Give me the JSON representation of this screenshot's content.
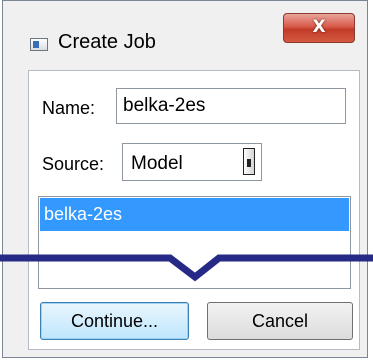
{
  "window": {
    "title": "Create Job",
    "close_glyph": "X"
  },
  "form": {
    "name_label": "Name:",
    "name_value": "belka-2es",
    "source_label": "Source:",
    "source_value": "Model"
  },
  "model_list": {
    "items": [
      "belka-2es"
    ],
    "selected_index": 0
  },
  "buttons": {
    "continue_label": "Continue...",
    "cancel_label": "Cancel"
  },
  "colors": {
    "selection": "#3399ff",
    "close_button": "#c23b28",
    "break_line": "#262a86"
  },
  "icons": {
    "window_icon": "create-job-window-icon",
    "dropdown": "dropdown-handle-icon"
  }
}
